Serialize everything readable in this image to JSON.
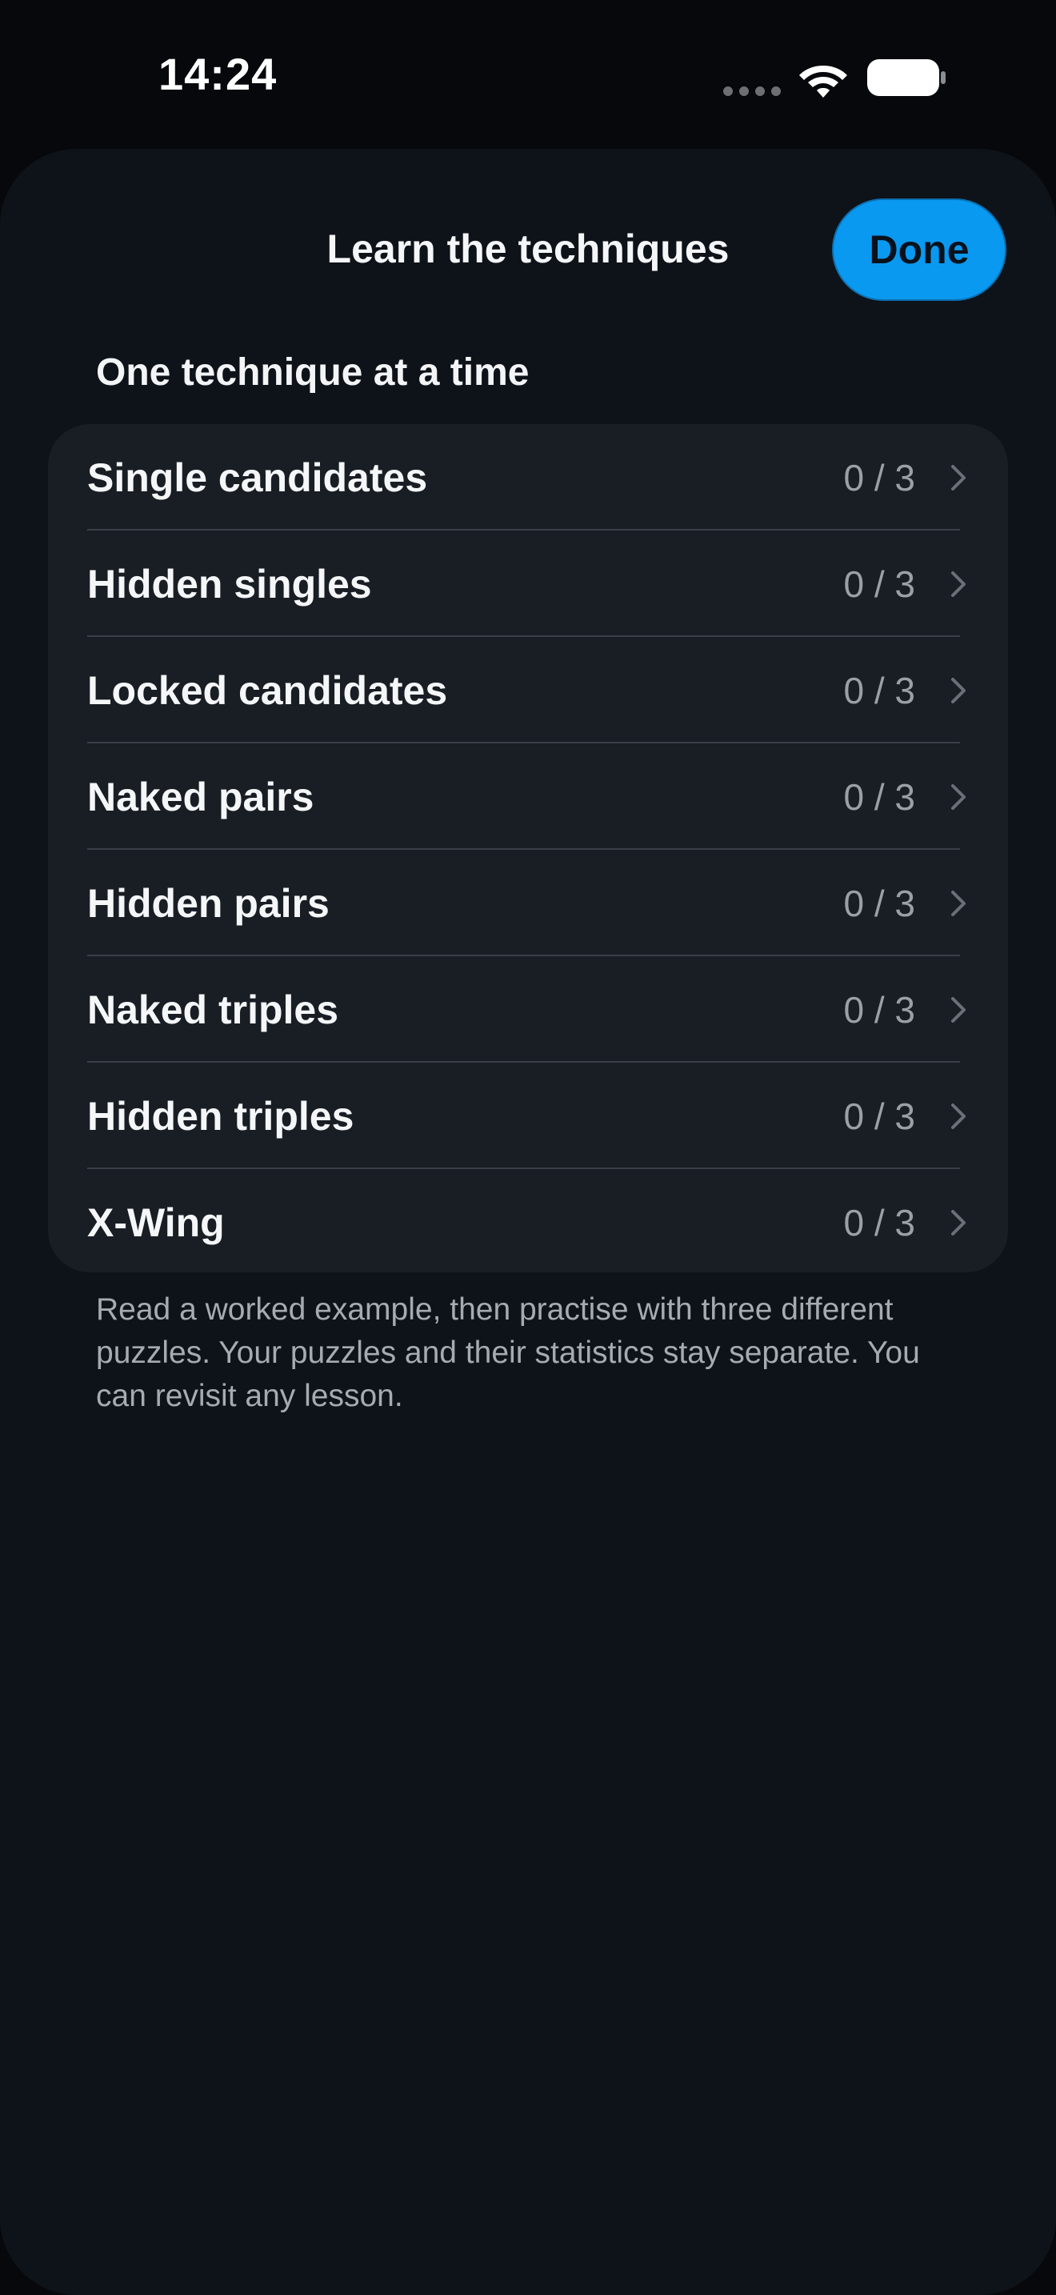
{
  "status_bar": {
    "time": "14:24"
  },
  "sheet": {
    "title": "Learn the techniques",
    "done_label": "Done",
    "section_header": "One technique at a time",
    "footnote": "Read a worked example, then practise with three different puzzles. Your puzzles and their statistics stay separate. You can revisit any lesson."
  },
  "techniques": [
    {
      "label": "Single candidates",
      "progress": "0 / 3"
    },
    {
      "label": "Hidden singles",
      "progress": "0 / 3"
    },
    {
      "label": "Locked candidates",
      "progress": "0 / 3"
    },
    {
      "label": "Naked pairs",
      "progress": "0 / 3"
    },
    {
      "label": "Hidden pairs",
      "progress": "0 / 3"
    },
    {
      "label": "Naked triples",
      "progress": "0 / 3"
    },
    {
      "label": "Hidden triples",
      "progress": "0 / 3"
    },
    {
      "label": "X-Wing",
      "progress": "0 / 3"
    }
  ],
  "icons": {
    "signal": "cellular-signal-icon",
    "wifi": "wifi-icon",
    "battery": "battery-icon",
    "chevron": "chevron-right-icon"
  },
  "colors": {
    "accent": "#0a99f0",
    "background": "#06080b",
    "sheet": "#0e1319",
    "list": "#181e24",
    "secondary_text": "#9aa0a6"
  }
}
